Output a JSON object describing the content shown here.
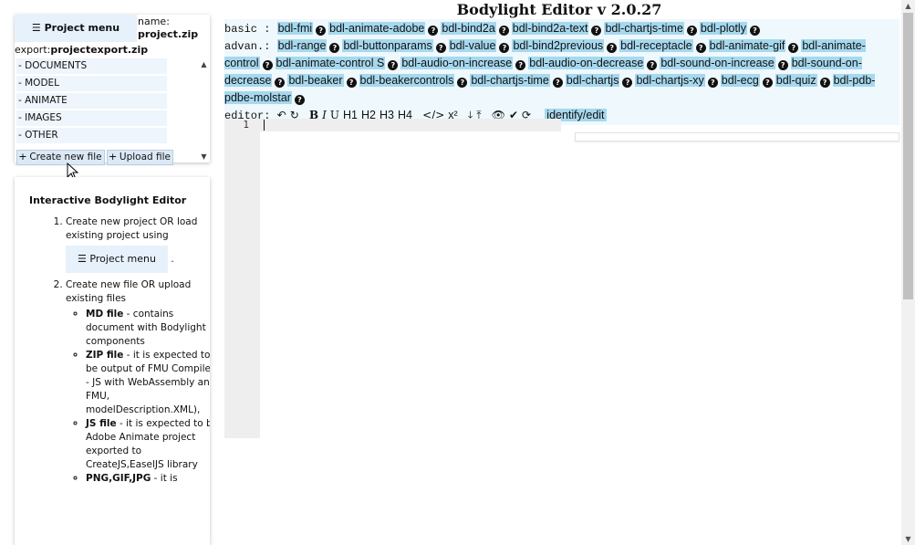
{
  "project_panel": {
    "menu_label": "☰ Project menu",
    "name_label": "name:",
    "name_value": "project.zip",
    "export_label": "export:",
    "export_value": "projectexport.zip",
    "folders": [
      "- DOCUMENTS",
      "- MODEL",
      "- ANIMATE",
      "- IMAGES",
      "- OTHER"
    ],
    "create_file_label": "🞤 Create new file",
    "upload_file_label": "🞤 Upload file"
  },
  "help": {
    "title": "Interactive Bodylight Editor",
    "step1_text": "Create new project OR load existing project using",
    "step1_button": "☰ Project menu",
    "step1_suffix": ".",
    "step2_text": "Create new file OR upload existing files",
    "file_types": [
      {
        "name": "MD file",
        "desc": " - contains document with Bodylight components"
      },
      {
        "name": "ZIP file",
        "desc": " - it is expected to be output of FMU Compiler - JS with WebAssembly and FMU, modelDescription.XML),"
      },
      {
        "name": "JS file",
        "desc": " - it is expected to be Adobe Animate project exported to CreateJS,EaselJS library"
      },
      {
        "name": "PNG,GIF,JPG",
        "desc": " - it is"
      }
    ]
  },
  "main": {
    "title": "Bodylight Editor v 2.0.27",
    "basic_label": "basic :",
    "basic_components": [
      "bdl-fmi",
      "bdl-animate-adobe",
      "bdl-bind2a",
      "bdl-bind2a-text",
      "bdl-chartjs-time",
      "bdl-plotly"
    ],
    "advanced_label": "advan.:",
    "advanced_components": [
      "bdl-range",
      "bdl-buttonparams",
      "bdl-value",
      "bdl-bind2previous",
      "bdl-receptacle",
      "bdl-animate-gif",
      "bdl-animate-control",
      "bdl-animate-control S",
      "bdl-audio-on-increase",
      "bdl-audio-on-decrease",
      "bdl-sound-on-increase",
      "bdl-sound-on-decrease",
      "bdl-beaker",
      "bdl-beakercontrols",
      "bdl-chartjs-time",
      "bdl-chartjs",
      "bdl-chartjs-xy",
      "bdl-ecg",
      "bdl-quiz",
      "bdl-pdb-pdbe-molstar"
    ],
    "editor_label": "editor:",
    "undo": "↶",
    "redo": "↻",
    "bold": "B",
    "italic": "I",
    "underline": "U",
    "h1": "H1",
    "h2": "H2",
    "h3": "H3",
    "h4": "H4",
    "code": "</>",
    "sup": "x²",
    "download": "⤓",
    "upload": "⤒",
    "preview": "👁",
    "check": "✔",
    "refresh": "⟳",
    "identify_label": "identify/edit",
    "line_number": "1"
  },
  "colors": {
    "component_bg": "#a6d8ee",
    "toolbar_bg": "#eff8fc",
    "menu_bg": "#e6f1fb"
  }
}
